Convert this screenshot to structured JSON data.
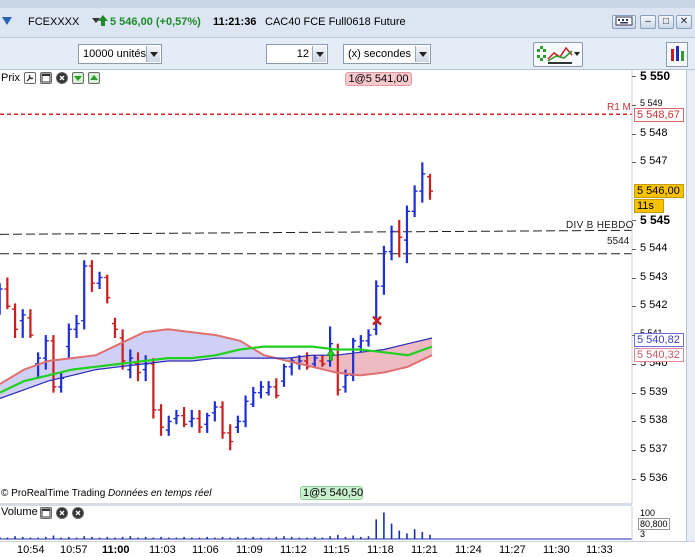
{
  "window": {
    "symbol": "FCEXXXX",
    "last_price_change": "5 546,00 (+0,57%)",
    "clock": "11:21:36",
    "contract": "CAC40 FCE Full0618 Future",
    "buttons": {
      "minimize": "–",
      "maximize": "□",
      "close": "✕"
    }
  },
  "toolbar": {
    "units": "10000 unités",
    "period_number": "12",
    "period_unit": "(x) secondes"
  },
  "price_panel": {
    "label": "Prix",
    "high_tag": "1@5 541,00",
    "low_tag": "1@5 540,50",
    "r1_label": "R1 M",
    "r1_tag": "5 548,67",
    "last_tag": "5 546,00",
    "timer_tag": "11s",
    "div_label": "DIV B HEBDO",
    "level_label": "5544",
    "blue_tag": "5 540,82",
    "pink_tag": "5 540,32",
    "copyright": "© ProRealTime Trading",
    "realtime": "Données en temps réel",
    "y_labels": [
      "5 550",
      "5 549",
      "5 548",
      "5 547",
      "5 545",
      "5 544",
      "5 543",
      "5 542",
      "5 541",
      "5 540",
      "5 539",
      "5 538",
      "5 537",
      "5 536"
    ]
  },
  "volume_panel": {
    "label": "Volume",
    "y_labels": [
      "100",
      "80,800",
      "3"
    ]
  },
  "time_axis": [
    "10:54",
    "10:57",
    "11:00",
    "11:03",
    "11:06",
    "11:09",
    "11:12",
    "11:15",
    "11:18",
    "11:21",
    "11:24",
    "11:27",
    "11:30",
    "11:33"
  ],
  "colors": {
    "up": "#1f2fd6",
    "down": "#c81e1e",
    "green_ma": "#22d022",
    "blue_ma": "#2a2ab8",
    "cloud_fill": "#c8c8f5",
    "cloud_red": "#e07070",
    "r1": "#dd2222",
    "last": "#f7c300"
  },
  "chart_data": {
    "type": "bar",
    "ylim": [
      5535.7,
      5550.7
    ],
    "grid": false,
    "bars": [
      {
        "t": "10:54a",
        "o": 5541.8,
        "h": 5542.3,
        "l": 5541.2,
        "c": 5541.5
      },
      {
        "t": "10:54b",
        "o": 5542.0,
        "h": 5542.8,
        "l": 5541.7,
        "c": 5542.6
      },
      {
        "t": "10:55a",
        "o": 5542.6,
        "h": 5543.0,
        "l": 5541.9,
        "c": 5542.0
      },
      {
        "t": "10:55b",
        "o": 5541.9,
        "h": 5542.1,
        "l": 5540.9,
        "c": 5541.2
      },
      {
        "t": "10:56a",
        "o": 5541.5,
        "h": 5541.9,
        "l": 5540.9,
        "c": 5541.7
      },
      {
        "t": "10:56b",
        "o": 5541.6,
        "h": 5541.9,
        "l": 5540.9,
        "c": 5541.0
      },
      {
        "t": "10:57a",
        "o": 5540.0,
        "h": 5540.4,
        "l": 5539.5,
        "c": 5540.2
      },
      {
        "t": "10:57b",
        "o": 5540.2,
        "h": 5541.0,
        "l": 5539.8,
        "c": 5540.8
      },
      {
        "t": "10:58a",
        "o": 5540.8,
        "h": 5541.0,
        "l": 5539.0,
        "c": 5539.2
      },
      {
        "t": "10:58b",
        "o": 5539.2,
        "h": 5539.7,
        "l": 5539.0,
        "c": 5539.5
      },
      {
        "t": "10:59a",
        "o": 5540.6,
        "h": 5541.4,
        "l": 5540.2,
        "c": 5541.2
      },
      {
        "t": "10:59b",
        "o": 5541.2,
        "h": 5541.7,
        "l": 5540.9,
        "c": 5541.4
      },
      {
        "t": "11:00a",
        "o": 5541.5,
        "h": 5543.6,
        "l": 5541.2,
        "c": 5543.4
      },
      {
        "t": "11:00b",
        "o": 5543.4,
        "h": 5543.6,
        "l": 5542.5,
        "c": 5542.8
      },
      {
        "t": "11:01a",
        "o": 5542.8,
        "h": 5543.2,
        "l": 5542.6,
        "c": 5543.0
      },
      {
        "t": "11:01b",
        "o": 5543.0,
        "h": 5543.1,
        "l": 5542.1,
        "c": 5542.3
      },
      {
        "t": "11:02a",
        "o": 5541.4,
        "h": 5541.6,
        "l": 5540.9,
        "c": 5541.2
      },
      {
        "t": "11:02b",
        "o": 5540.9,
        "h": 5541.2,
        "l": 5539.8,
        "c": 5540.1
      },
      {
        "t": "11:03a",
        "o": 5539.8,
        "h": 5540.5,
        "l": 5539.5,
        "c": 5540.2
      },
      {
        "t": "11:03b",
        "o": 5540.0,
        "h": 5540.4,
        "l": 5539.4,
        "c": 5539.7
      },
      {
        "t": "11:04a",
        "o": 5539.8,
        "h": 5540.3,
        "l": 5539.4,
        "c": 5540.0
      },
      {
        "t": "11:04b",
        "o": 5540.0,
        "h": 5540.2,
        "l": 5538.1,
        "c": 5538.4
      },
      {
        "t": "11:05a",
        "o": 5538.4,
        "h": 5538.6,
        "l": 5537.5,
        "c": 5537.8
      },
      {
        "t": "11:05b",
        "o": 5537.7,
        "h": 5538.2,
        "l": 5537.5,
        "c": 5538.0
      },
      {
        "t": "11:06a",
        "o": 5538.1,
        "h": 5538.4,
        "l": 5537.9,
        "c": 5538.2
      },
      {
        "t": "11:06b",
        "o": 5538.2,
        "h": 5538.5,
        "l": 5537.8,
        "c": 5537.9
      },
      {
        "t": "11:07a",
        "o": 5538.0,
        "h": 5538.4,
        "l": 5537.8,
        "c": 5538.1
      },
      {
        "t": "11:07b",
        "o": 5538.1,
        "h": 5538.4,
        "l": 5537.6,
        "c": 5537.8
      },
      {
        "t": "11:08a",
        "o": 5537.9,
        "h": 5538.3,
        "l": 5537.6,
        "c": 5538.2
      },
      {
        "t": "11:08b",
        "o": 5538.3,
        "h": 5538.7,
        "l": 5538.0,
        "c": 5538.5
      },
      {
        "t": "11:09a",
        "o": 5538.5,
        "h": 5538.7,
        "l": 5537.4,
        "c": 5537.6
      },
      {
        "t": "11:09b",
        "o": 5537.6,
        "h": 5537.9,
        "l": 5537.0,
        "c": 5537.3
      },
      {
        "t": "11:10a",
        "o": 5537.8,
        "h": 5538.2,
        "l": 5537.6,
        "c": 5538.0
      },
      {
        "t": "11:10b",
        "o": 5538.0,
        "h": 5538.9,
        "l": 5537.8,
        "c": 5538.7
      },
      {
        "t": "11:11a",
        "o": 5538.6,
        "h": 5539.2,
        "l": 5538.5,
        "c": 5539.0
      },
      {
        "t": "11:11b",
        "o": 5539.0,
        "h": 5539.4,
        "l": 5538.8,
        "c": 5539.2
      },
      {
        "t": "11:12a",
        "o": 5539.0,
        "h": 5539.4,
        "l": 5538.9,
        "c": 5539.2
      },
      {
        "t": "11:12b",
        "o": 5539.2,
        "h": 5539.5,
        "l": 5538.8,
        "c": 5538.9
      },
      {
        "t": "11:13a",
        "o": 5539.4,
        "h": 5540.0,
        "l": 5539.2,
        "c": 5539.9
      },
      {
        "t": "11:13b",
        "o": 5539.9,
        "h": 5540.2,
        "l": 5539.6,
        "c": 5540.1
      },
      {
        "t": "11:14a",
        "o": 5540.0,
        "h": 5540.3,
        "l": 5539.8,
        "c": 5540.1
      },
      {
        "t": "11:14b",
        "o": 5540.1,
        "h": 5540.4,
        "l": 5539.8,
        "c": 5539.9
      },
      {
        "t": "11:15a",
        "o": 5540.0,
        "h": 5540.3,
        "l": 5539.9,
        "c": 5540.2
      },
      {
        "t": "11:15b",
        "o": 5540.1,
        "h": 5540.3,
        "l": 5539.9,
        "c": 5540.0
      },
      {
        "t": "11:16a",
        "o": 5540.1,
        "h": 5541.3,
        "l": 5539.9,
        "c": 5540.7
      },
      {
        "t": "11:16b",
        "o": 5540.5,
        "h": 5540.7,
        "l": 5538.9,
        "c": 5539.1
      },
      {
        "t": "11:17a",
        "o": 5539.2,
        "h": 5539.8,
        "l": 5539.0,
        "c": 5539.6
      },
      {
        "t": "11:17b",
        "o": 5539.6,
        "h": 5540.9,
        "l": 5539.4,
        "c": 5540.8
      },
      {
        "t": "11:18a",
        "o": 5540.6,
        "h": 5541.0,
        "l": 5540.4,
        "c": 5540.8
      },
      {
        "t": "11:18b",
        "o": 5540.8,
        "h": 5541.2,
        "l": 5540.6,
        "c": 5541.0
      },
      {
        "t": "11:19a",
        "o": 5541.2,
        "h": 5542.9,
        "l": 5541.0,
        "c": 5542.7
      },
      {
        "t": "11:19b",
        "o": 5542.7,
        "h": 5544.1,
        "l": 5542.4,
        "c": 5543.9
      },
      {
        "t": "11:20a",
        "o": 5543.9,
        "h": 5544.8,
        "l": 5543.6,
        "c": 5544.6
      },
      {
        "t": "11:20b",
        "o": 5544.6,
        "h": 5545.0,
        "l": 5543.7,
        "c": 5544.4
      },
      {
        "t": "11:21a",
        "o": 5544.3,
        "h": 5545.5,
        "l": 5543.5,
        "c": 5545.3
      },
      {
        "t": "11:21b",
        "o": 5545.3,
        "h": 5546.2,
        "l": 5545.1,
        "c": 5546.0
      },
      {
        "t": "11:21c",
        "o": 5546.0,
        "h": 5547.0,
        "l": 5545.6,
        "c": 5546.6
      },
      {
        "t": "11:21d",
        "o": 5546.5,
        "h": 5546.6,
        "l": 5545.7,
        "c": 5546.0
      }
    ],
    "green_ma": [
      5539.0,
      5539.4,
      5539.6,
      5539.8,
      5539.9,
      5540.0,
      5540.1,
      5540.2,
      5540.2,
      5540.3,
      5540.5,
      5540.6,
      5540.6,
      5540.6,
      5540.5,
      5540.5,
      5540.4,
      5540.3,
      5540.6
    ],
    "blue_ma": [
      5538.8,
      5539.1,
      5539.4,
      5539.6,
      5539.8,
      5539.9,
      5540.0,
      5540.1,
      5540.1,
      5540.2,
      5540.2,
      5540.2,
      5540.2,
      5540.3,
      5540.3,
      5540.4,
      5540.5,
      5540.7,
      5540.9
    ],
    "red_ma": [
      5539.3,
      5539.8,
      5540.1,
      5540.2,
      5540.3,
      5540.7,
      5541.1,
      5541.2,
      5541.1,
      5541.0,
      5540.8,
      5540.3,
      5540.1,
      5539.9,
      5539.7,
      5539.6,
      5539.7,
      5539.9,
      5540.3
    ],
    "r1_level": 5548.67,
    "div_level": 5544.5,
    "s_level": 5544.0,
    "volume": [
      2,
      3,
      2,
      4,
      3,
      2,
      2,
      3,
      5,
      2,
      3,
      2,
      4,
      3,
      2,
      3,
      2,
      3,
      4,
      2,
      3,
      2,
      3,
      2,
      2,
      3,
      2,
      2,
      3,
      2,
      3,
      2,
      3,
      2,
      3,
      2,
      2,
      3,
      4,
      3,
      2,
      2,
      3,
      2,
      4,
      6,
      3,
      5,
      3,
      4,
      28,
      38,
      22,
      12,
      8,
      14,
      10,
      6
    ]
  }
}
